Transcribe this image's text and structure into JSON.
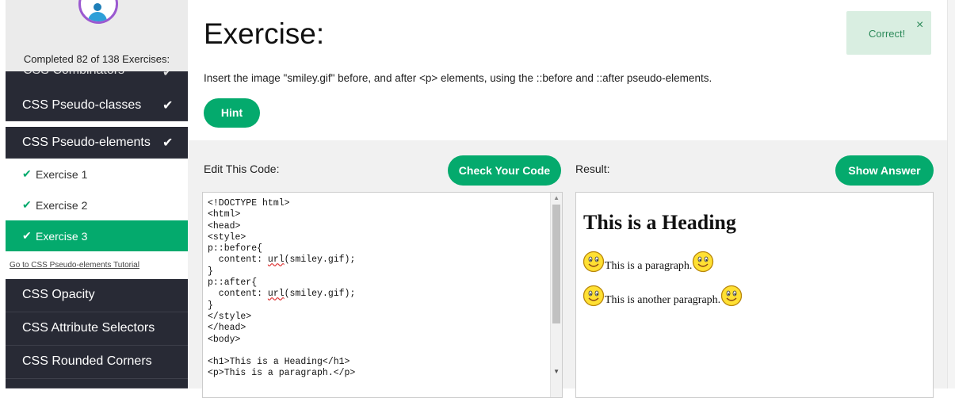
{
  "sidebar": {
    "completed_text": "Completed 82 of 138 Exercises:",
    "clipped_item": "CSS Combinators",
    "sections": [
      {
        "label": "CSS Pseudo-classes",
        "done": true
      },
      {
        "label": "CSS Pseudo-elements",
        "done": true
      }
    ],
    "exercises": [
      {
        "label": "Exercise 1",
        "active": false
      },
      {
        "label": "Exercise 2",
        "active": false
      },
      {
        "label": "Exercise 3",
        "active": true
      }
    ],
    "tutorial_link": "Go to CSS Pseudo-elements Tutorial",
    "more_sections": [
      "CSS Opacity",
      "CSS Attribute Selectors",
      "CSS Rounded Corners"
    ]
  },
  "exercise": {
    "title": "Exercise:",
    "instruction": "Insert the image \"smiley.gif\" before, and after <p> elements, using the ::before and ::after pseudo-elements.",
    "hint_label": "Hint"
  },
  "toast": {
    "message": "Correct!",
    "close_glyph": "×"
  },
  "editor": {
    "label": "Edit This Code:",
    "check_button": "Check Your Code",
    "code_lines": [
      "<!DOCTYPE html>",
      "<html>",
      "<head>",
      "<style>",
      "p::before{",
      "  content: url(smiley.gif);",
      "}",
      "p::after{",
      "  content: url(smiley.gif);",
      "}",
      "</style>",
      "</head>",
      "<body>",
      "",
      "<h1>This is a Heading</h1>",
      "<p>This is a paragraph.</p>"
    ]
  },
  "result": {
    "label": "Result:",
    "show_answer_button": "Show Answer",
    "heading": "This is a Heading",
    "paragraphs": [
      "This is a paragraph.",
      "This is another paragraph."
    ]
  },
  "colors": {
    "accent": "#04aa6d",
    "sidebar_dark": "#282a35",
    "toast_bg": "#d9eee1",
    "smiley": "#ffe033"
  }
}
